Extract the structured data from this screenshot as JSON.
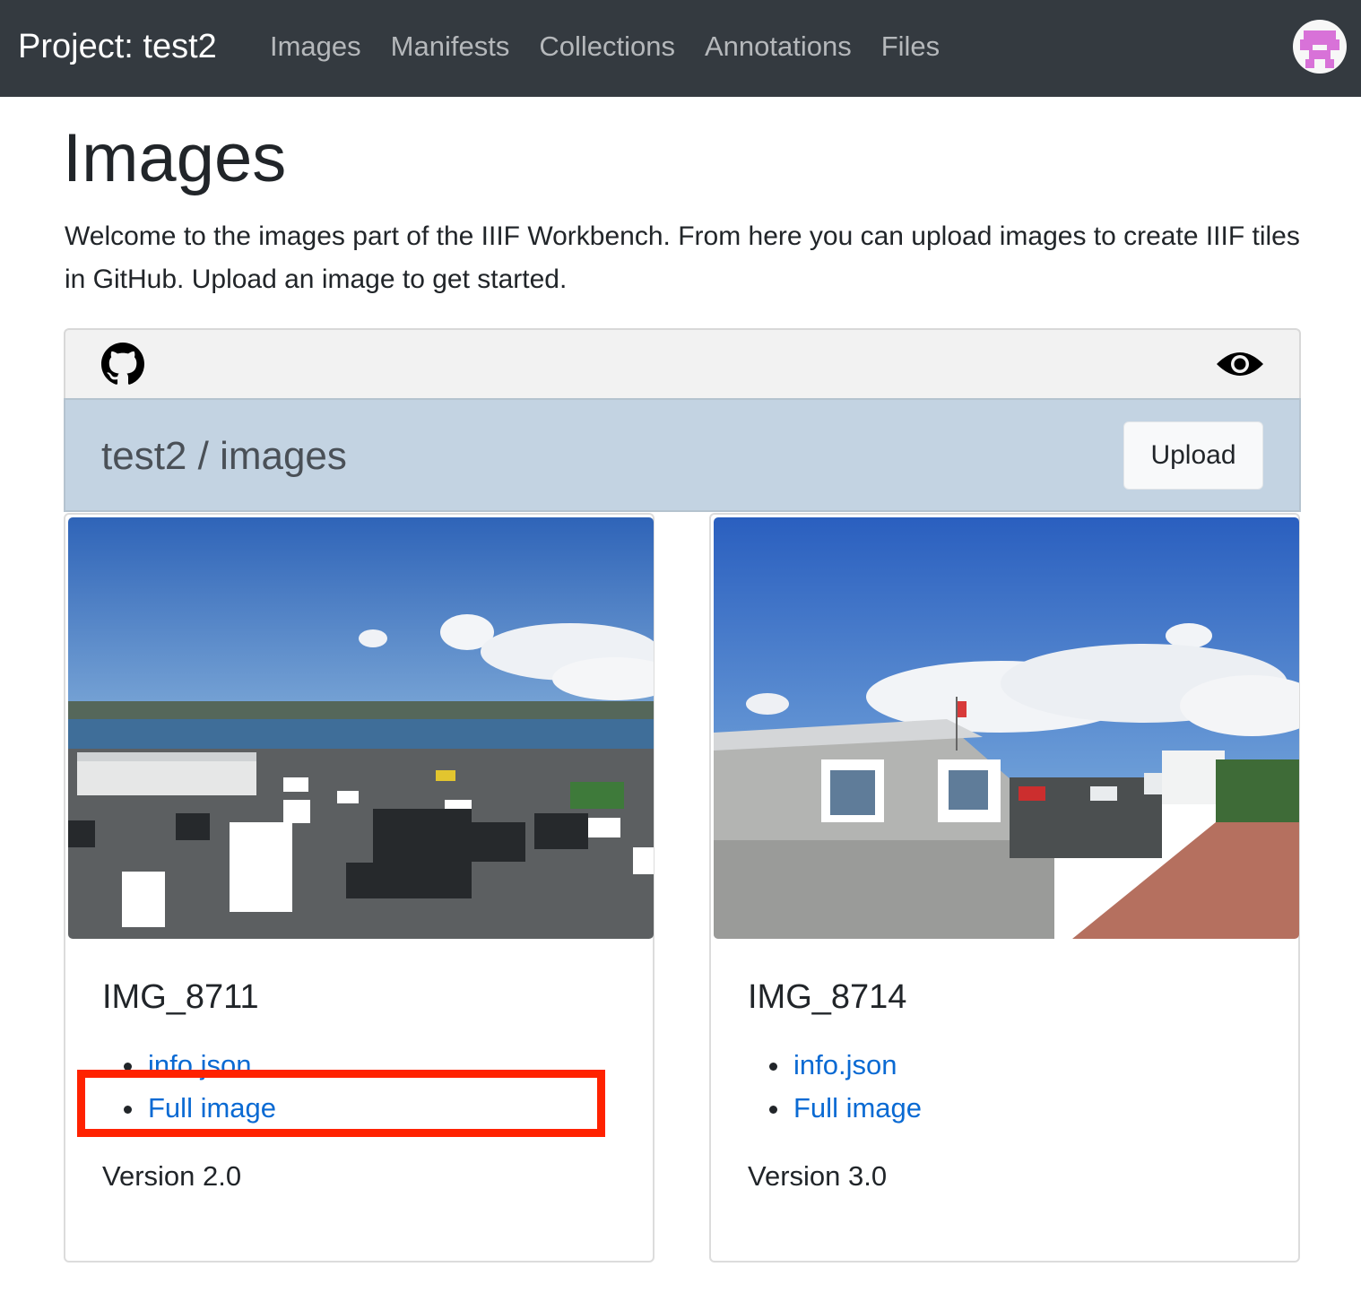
{
  "navbar": {
    "brand": "Project: test2",
    "links": [
      "Images",
      "Manifests",
      "Collections",
      "Annotations",
      "Files"
    ]
  },
  "page": {
    "title": "Images",
    "intro": "Welcome to the images part of the IIIF Workbench. From here you can upload images to create IIIF tiles in GitHub. Upload an image to get started."
  },
  "repo": {
    "path": "test2 / images",
    "upload_label": "Upload"
  },
  "cards": [
    {
      "title": "IMG_8711",
      "links": [
        "info.json",
        "Full image"
      ],
      "version": "Version 2.0"
    },
    {
      "title": "IMG_8714",
      "links": [
        "info.json",
        "Full image"
      ],
      "version": "Version 3.0"
    }
  ],
  "colors": {
    "navbar_bg": "#343a40",
    "link": "#0a6ad3",
    "repo_bar": "#c3d3e2",
    "highlight": "#ff2200"
  },
  "icons": [
    "github-icon",
    "eye-icon",
    "avatar"
  ]
}
